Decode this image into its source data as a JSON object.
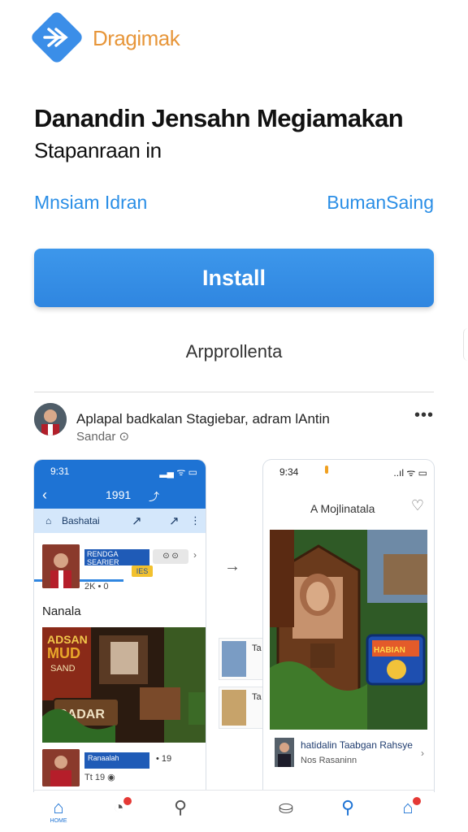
{
  "app": {
    "brand": "Dragimak",
    "title": "Danandin Jensahn Megiamakan",
    "subtitle": "Stapanraan in",
    "links": {
      "left": "Mnsiam Idran",
      "right": "BumanSaing"
    },
    "install_label": "Install",
    "meta_line": "Arpprollenta"
  },
  "post": {
    "title": "Aplapal badkalan Stagiebar, adram lAntin",
    "subtitle": "Sandar ⊙",
    "more": "•••"
  },
  "phone_left": {
    "time": "9:31",
    "signal": "▂▄ ᯤ ▭",
    "back": "‹",
    "nav_title": "1991",
    "nav_icon": "⤴",
    "tab_home_icon": "⌂",
    "tab_label": "Bashatai",
    "share1": "↗",
    "share2": "↗",
    "more": "⋮",
    "card1": {
      "tag": "RENDGA SEARIER",
      "pill": "⊙ ⊙",
      "badge": "IES",
      "meta": "2K  • 0"
    },
    "section": "Nanala",
    "card2": {
      "tag": "Ranaalah",
      "count": "• 19",
      "meta": "Tt  19  ◉"
    }
  },
  "mini_cards": [
    {
      "text": "Ta"
    },
    {
      "text": "Ta"
    }
  ],
  "phone_right": {
    "time": "9:34",
    "signal": "..ıl ᯤ ▭",
    "title": "A Mojlinatala",
    "heart": "♡",
    "caption_title": "hatidalin Taabgan Rahsye",
    "caption_sub": "Nos Rasaninn"
  },
  "tabs": [
    {
      "name": "home",
      "glyph": "⌂",
      "label": "HOME"
    },
    {
      "name": "notifications",
      "glyph": "◔"
    },
    {
      "name": "search",
      "glyph": "⚲"
    },
    {
      "name": "profile",
      "glyph": "⛀"
    },
    {
      "name": "search-2",
      "glyph": "⚲"
    },
    {
      "name": "inbox",
      "glyph": "⌂"
    }
  ],
  "colors": {
    "accent": "#2f86e0",
    "brand": "#e7963a",
    "nav_blue": "#1e73d4"
  }
}
